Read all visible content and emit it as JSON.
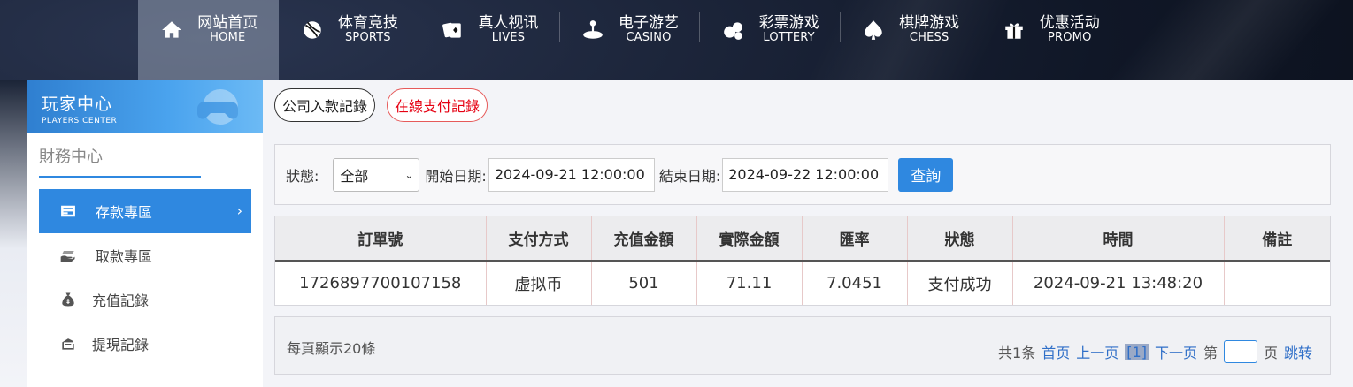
{
  "nav": {
    "items": [
      {
        "cn": "网站首页",
        "en": "HOME",
        "icon": "home-icon",
        "active": true
      },
      {
        "cn": "体育竞技",
        "en": "SPORTS",
        "icon": "ball-icon"
      },
      {
        "cn": "真人视讯",
        "en": "LIVES",
        "icon": "cards-icon"
      },
      {
        "cn": "电子游艺",
        "en": "CASINO",
        "icon": "joystick-icon"
      },
      {
        "cn": "彩票游戏",
        "en": "LOTTERY",
        "icon": "lottery-balls-icon"
      },
      {
        "cn": "棋牌游戏",
        "en": "CHESS",
        "icon": "spade-icon"
      },
      {
        "cn": "优惠活动",
        "en": "PROMO",
        "icon": "gift-icon"
      }
    ]
  },
  "sidebar": {
    "header_cn": "玩家中心",
    "header_en": "PLAYERS CENTER",
    "section_title": "財務中心",
    "items": [
      {
        "label": "存款專區",
        "icon": "card-icon",
        "active": true
      },
      {
        "label": "取款專區",
        "icon": "cash-hand-icon"
      },
      {
        "label": "充值記錄",
        "icon": "money-bag-icon"
      },
      {
        "label": "提現記錄",
        "icon": "withdraw-icon"
      }
    ]
  },
  "tabs": [
    {
      "label": "公司入款記錄"
    },
    {
      "label": "在線支付記錄",
      "active": true
    }
  ],
  "filter": {
    "status_label": "狀態:",
    "status_value": "全部",
    "start_label": "開始日期:",
    "start_value": "2024-09-21 12:00:00",
    "end_label": "結束日期:",
    "end_value": "2024-09-22 12:00:00",
    "query_label": "查詢"
  },
  "table": {
    "headers": [
      "訂單號",
      "支付方式",
      "充值金額",
      "實際金額",
      "匯率",
      "狀態",
      "時間",
      "備註"
    ],
    "rows": [
      [
        "1726897700107158",
        "虚拟币",
        "501",
        "71.11",
        "7.0451",
        "支付成功",
        "2024-09-21 13:48:20",
        ""
      ]
    ]
  },
  "pager": {
    "per_page": "每頁顯示20條",
    "total": "共1条",
    "first": "首页",
    "prev": "上一页",
    "current": "[1]",
    "next": "下一页",
    "goto_prefix": "第",
    "goto_suffix": "页",
    "jump": "跳转"
  },
  "colors": {
    "accent": "#2f88e0",
    "active_tab_text": "#e60012"
  }
}
